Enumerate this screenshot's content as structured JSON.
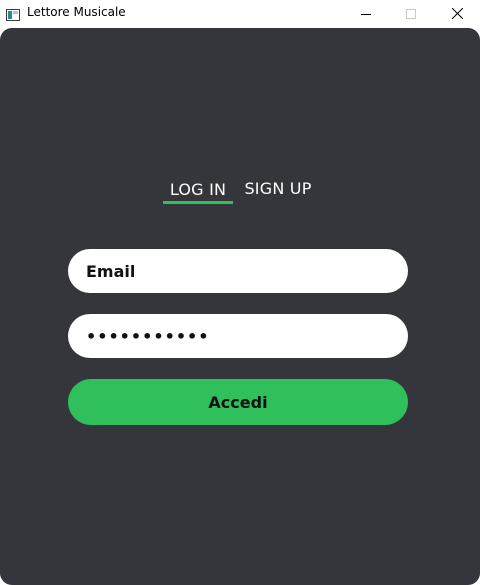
{
  "window": {
    "title": "Lettore Musicale",
    "icon": "app-window-icon",
    "controls": [
      "minimize-icon",
      "maximize-icon",
      "close-icon"
    ]
  },
  "tabs": {
    "login_label": "LOG IN",
    "signup_label": "SIGN UP",
    "active": "LOG IN"
  },
  "form": {
    "email_value": "Email",
    "password_value": "•••••••••••",
    "submit_label": "Accedi"
  },
  "colors": {
    "background": "#34363b",
    "accent": "#2fbf5b",
    "field_background": "#ffffff",
    "text_light": "#ffffff",
    "text_dark": "#111111"
  }
}
